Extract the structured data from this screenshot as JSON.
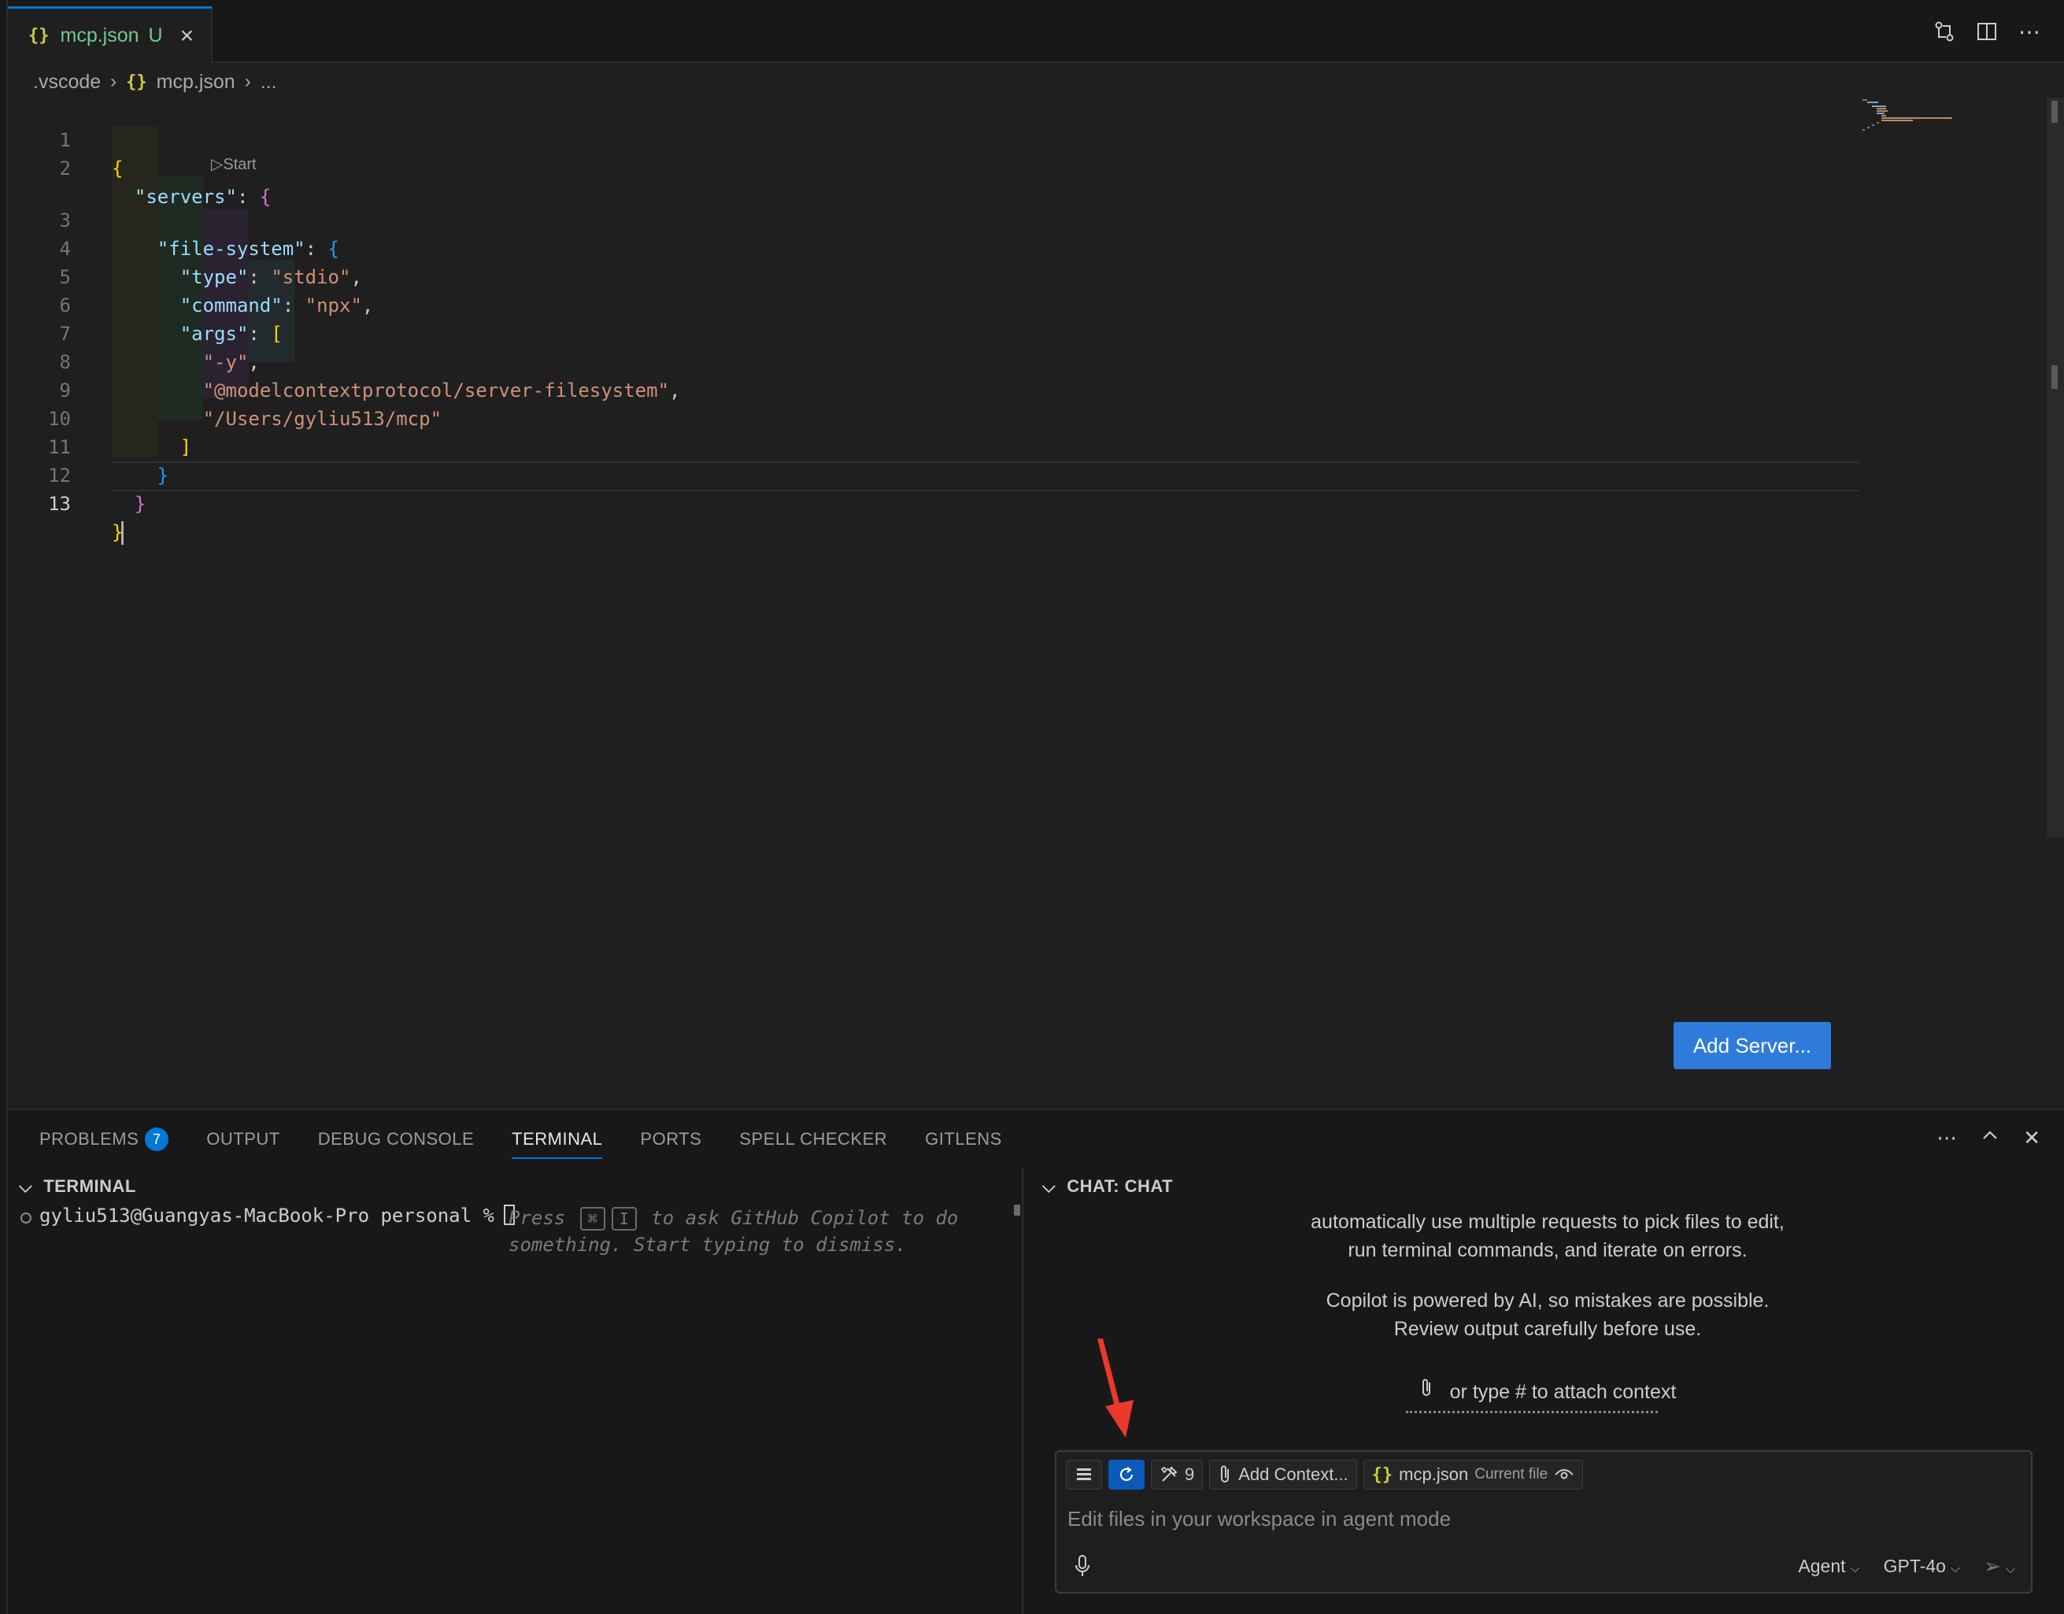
{
  "tab": {
    "icon": "{}",
    "label": "mcp.json",
    "status": "U"
  },
  "breadcrumb": {
    "folder": ".vscode",
    "file_icon": "{}",
    "file": "mcp.json",
    "more": "..."
  },
  "editor": {
    "codelens": "▷Start",
    "lines": [
      "1",
      "2",
      "3",
      "4",
      "5",
      "6",
      "7",
      "8",
      "9",
      "10",
      "11",
      "12",
      "13"
    ],
    "tokens": {
      "l1_open": "{",
      "servers_key": "\"servers\"",
      "fs_key": "\"file-system\"",
      "type_key": "\"type\"",
      "type_val": "\"stdio\"",
      "command_key": "\"command\"",
      "command_val": "\"npx\"",
      "args_key": "\"args\"",
      "arg1": "\"-y\"",
      "arg2": "\"@modelcontextprotocol/server-filesystem\"",
      "arg3": "\"/Users/gyliu513/mcp\""
    },
    "add_server_label": "Add Server..."
  },
  "panel": {
    "tabs": [
      {
        "label": "PROBLEMS",
        "badge": "7"
      },
      {
        "label": "OUTPUT"
      },
      {
        "label": "DEBUG CONSOLE"
      },
      {
        "label": "TERMINAL",
        "active": true
      },
      {
        "label": "PORTS"
      },
      {
        "label": "SPELL CHECKER"
      },
      {
        "label": "GITLENS"
      }
    ]
  },
  "terminal": {
    "title": "TERMINAL",
    "prompt": "gyliu513@Guangyas-MacBook-Pro personal %",
    "hint_press": "Press",
    "hint_key1": "⌘",
    "hint_key2": "I",
    "hint_rest": "to ask GitHub Copilot to do something. Start typing to dismiss."
  },
  "chat": {
    "title": "CHAT: CHAT",
    "msg1_line1": "automatically use multiple requests to pick files to edit,",
    "msg1_line2": "run terminal commands, and iterate on errors.",
    "msg2_line1": "Copilot is powered by AI, so mistakes are possible.",
    "msg2_line2": "Review output carefully before use.",
    "attach_hint": "or type # to attach context",
    "tools_count": "9",
    "add_context": "Add Context...",
    "file_chip": "mcp.json",
    "file_chip_sub": "Current file",
    "placeholder": "Edit files in your workspace in agent mode",
    "mode": "Agent",
    "model": "GPT-4o"
  },
  "colors": {
    "accent": "#0078d4",
    "button": "#2f7bdb",
    "arrow": "#e8392b"
  }
}
